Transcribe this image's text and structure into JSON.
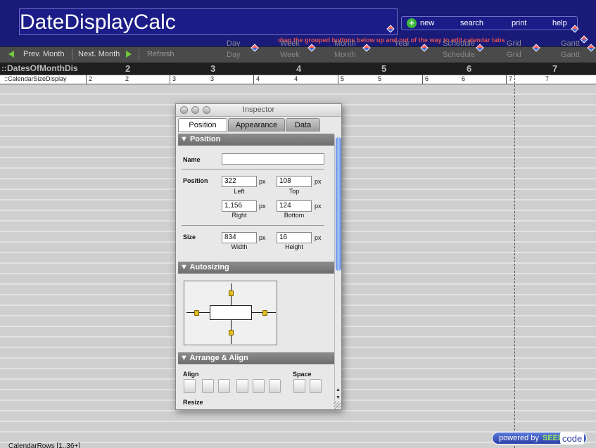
{
  "header": {
    "title": "DateDisplayCalc",
    "buttons": [
      {
        "label": "new",
        "icon": "plus-icon"
      },
      {
        "label": "search"
      },
      {
        "label": "print"
      },
      {
        "label": "help"
      }
    ],
    "notice": "drag the grouped buttons below up and out of the way to edit calendar tabs"
  },
  "nav": {
    "prev": "Prev. Month",
    "next": "Next. Month",
    "refresh": "Refresh"
  },
  "view_tabs": [
    "Day",
    "Week",
    "Month",
    "Year",
    "Schedule",
    "Grid",
    "Gantt"
  ],
  "days_header": {
    "field_label": "::DatesOfMonthDis",
    "numbers": [
      "2",
      "3",
      "4",
      "5",
      "6",
      "7"
    ]
  },
  "dates_row": {
    "label": "::CalendarSizeDisplay",
    "cells": [
      "2",
      "2",
      "3",
      "3",
      "4",
      "4",
      "5",
      "5",
      "6",
      "6",
      "7",
      "7"
    ]
  },
  "footer": {
    "layout_label": "CalendarRows [1..36+]",
    "badge": {
      "prefix": "powered by",
      "brand1": "SEED",
      "brand2": "code"
    }
  },
  "inspector": {
    "title": "Inspector",
    "tabs": [
      "Position",
      "Appearance",
      "Data"
    ],
    "selected_tab": "Position",
    "sections": {
      "position": "Position",
      "autosizing": "Autosizing",
      "arrange": "Arrange & Align"
    },
    "name_label": "Name",
    "name_value": "",
    "position_label": "Position",
    "left": "322",
    "top": "108",
    "right": "1,156",
    "bottom": "124",
    "size_label": "Size",
    "width": "834",
    "height": "16",
    "unit": "px",
    "labels": {
      "left": "Left",
      "top": "Top",
      "right": "Right",
      "bottom": "Bottom",
      "width": "Width",
      "height": "Height"
    },
    "align_label": "Align",
    "space_label": "Space",
    "resize_label": "Resize"
  }
}
